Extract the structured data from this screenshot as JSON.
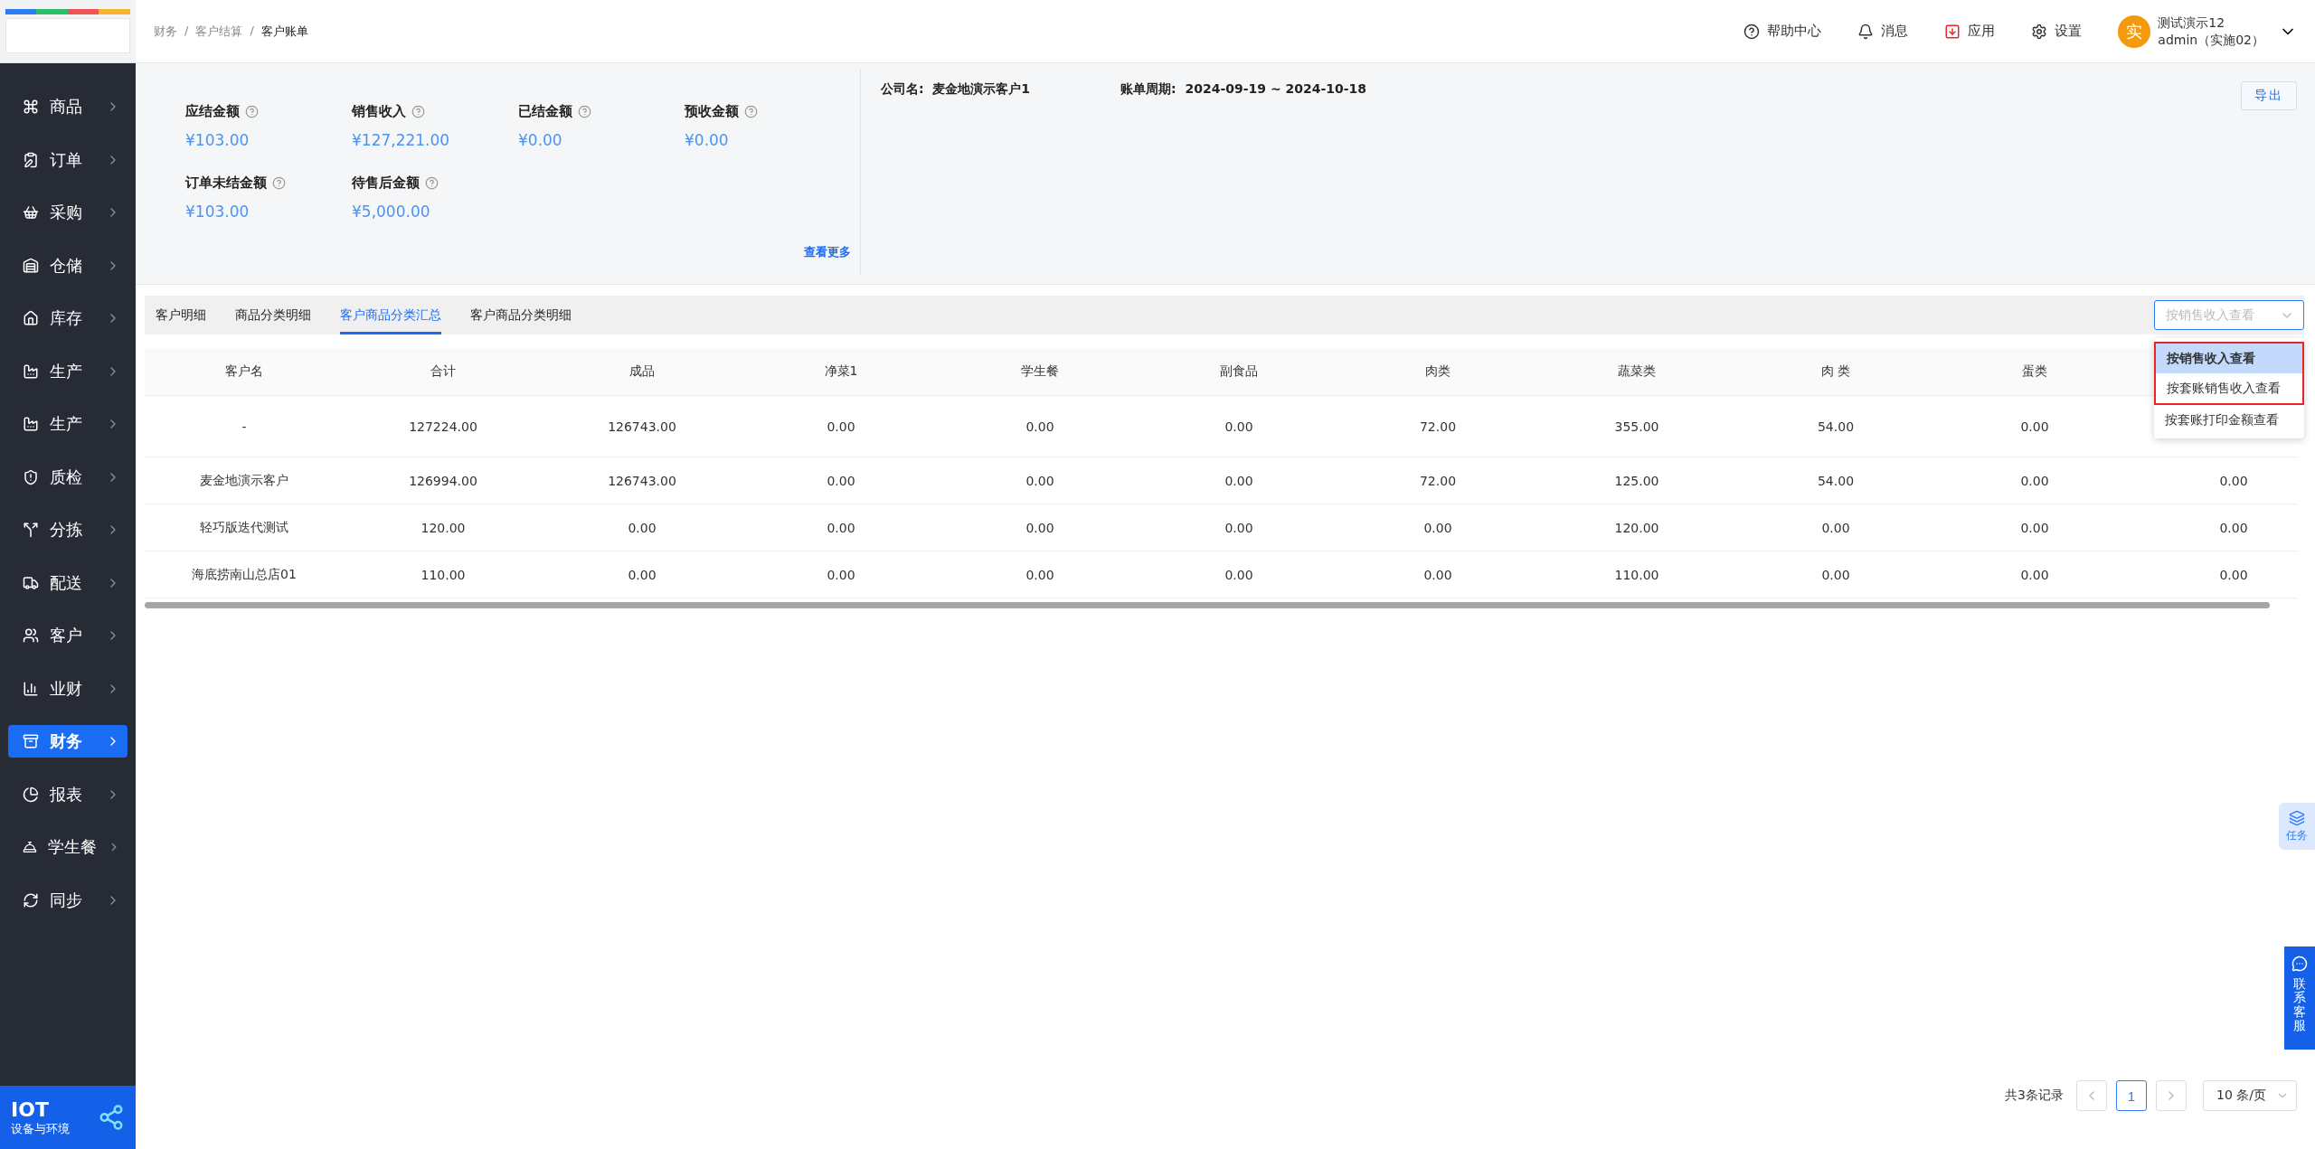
{
  "sidebar": {
    "banner": {
      "title": "IOT",
      "subtitle": "设备与环境"
    },
    "items": [
      {
        "label": "商品",
        "selected": false
      },
      {
        "label": "订单",
        "selected": false
      },
      {
        "label": "采购",
        "selected": false
      },
      {
        "label": "仓储",
        "selected": false
      },
      {
        "label": "库存",
        "selected": false
      },
      {
        "label": "生产",
        "selected": false
      },
      {
        "label": "生产",
        "selected": false
      },
      {
        "label": "质检",
        "selected": false
      },
      {
        "label": "分拣",
        "selected": false
      },
      {
        "label": "配送",
        "selected": false
      },
      {
        "label": "客户",
        "selected": false
      },
      {
        "label": "业财",
        "selected": false
      },
      {
        "label": "财务",
        "selected": true
      },
      {
        "label": "报表",
        "selected": false
      },
      {
        "label": "学生餐",
        "selected": false
      },
      {
        "label": "同步",
        "selected": false
      }
    ]
  },
  "breadcrumb": [
    "财务",
    "客户结算",
    "客户账单"
  ],
  "breadcrumb_separator": "/",
  "header": {
    "links": [
      "帮助中心",
      "消息",
      "应用",
      "设置"
    ],
    "user": {
      "avatar": "实",
      "name": "测试演示12",
      "account": "admin（实施02）"
    }
  },
  "summary": {
    "metrics": [
      {
        "label": "应结金额",
        "value": "¥103.00"
      },
      {
        "label": "销售收入",
        "value": "¥127,221.00"
      },
      {
        "label": "已结金额",
        "value": "¥0.00"
      },
      {
        "label": "预收金额",
        "value": "¥0.00"
      },
      {
        "label": "订单未结金额",
        "value": "¥103.00"
      },
      {
        "label": "待售后金额",
        "value": "¥5,000.00"
      }
    ],
    "more_link": "查看更多",
    "company": {
      "label": "公司名:",
      "value": "麦金地演示客户1"
    },
    "period": {
      "label": "账单周期:",
      "value": "2024-09-19 ~ 2024-10-18"
    },
    "export_button": "导出"
  },
  "tabs": [
    {
      "label": "客户明细",
      "selected": false
    },
    {
      "label": "商品分类明细",
      "selected": false
    },
    {
      "label": "客户商品分类汇总",
      "selected": true
    },
    {
      "label": "客户商品分类明细",
      "selected": false
    }
  ],
  "view_select": {
    "placeholder": "按销售收入查看",
    "options": [
      {
        "label": "按销售收入查看",
        "selected": true,
        "highlighted": true
      },
      {
        "label": "按套账销售收入查看",
        "selected": false,
        "highlighted": true
      },
      {
        "label": "按套账打印金额查看",
        "selected": false,
        "highlighted": false
      }
    ]
  },
  "table": {
    "columns": [
      "客户名",
      "合计",
      "成品",
      "净菜1",
      "学生餐",
      "副食品",
      "肉类",
      "蔬菜类",
      "肉 类",
      "蛋类"
    ],
    "rows": [
      [
        "-",
        "127224.00",
        "126743.00",
        "0.00",
        "0.00",
        "0.00",
        "72.00",
        "355.00",
        "54.00",
        "0.00"
      ],
      [
        "麦金地演示客户",
        "126994.00",
        "126743.00",
        "0.00",
        "0.00",
        "0.00",
        "72.00",
        "125.00",
        "54.00",
        "0.00",
        "0.00"
      ],
      [
        "轻巧版迭代测试",
        "120.00",
        "0.00",
        "0.00",
        "0.00",
        "0.00",
        "0.00",
        "120.00",
        "0.00",
        "0.00",
        "0.00"
      ],
      [
        "海底捞南山总店01",
        "110.00",
        "0.00",
        "0.00",
        "0.00",
        "0.00",
        "0.00",
        "110.00",
        "0.00",
        "0.00",
        "0.00"
      ]
    ]
  },
  "pagination": {
    "total": "共3条记录",
    "pages": [
      {
        "label": "1",
        "selected": true
      }
    ],
    "page_size": "10 条/页"
  },
  "floating": {
    "task": "任务",
    "support": "联系客服"
  }
}
